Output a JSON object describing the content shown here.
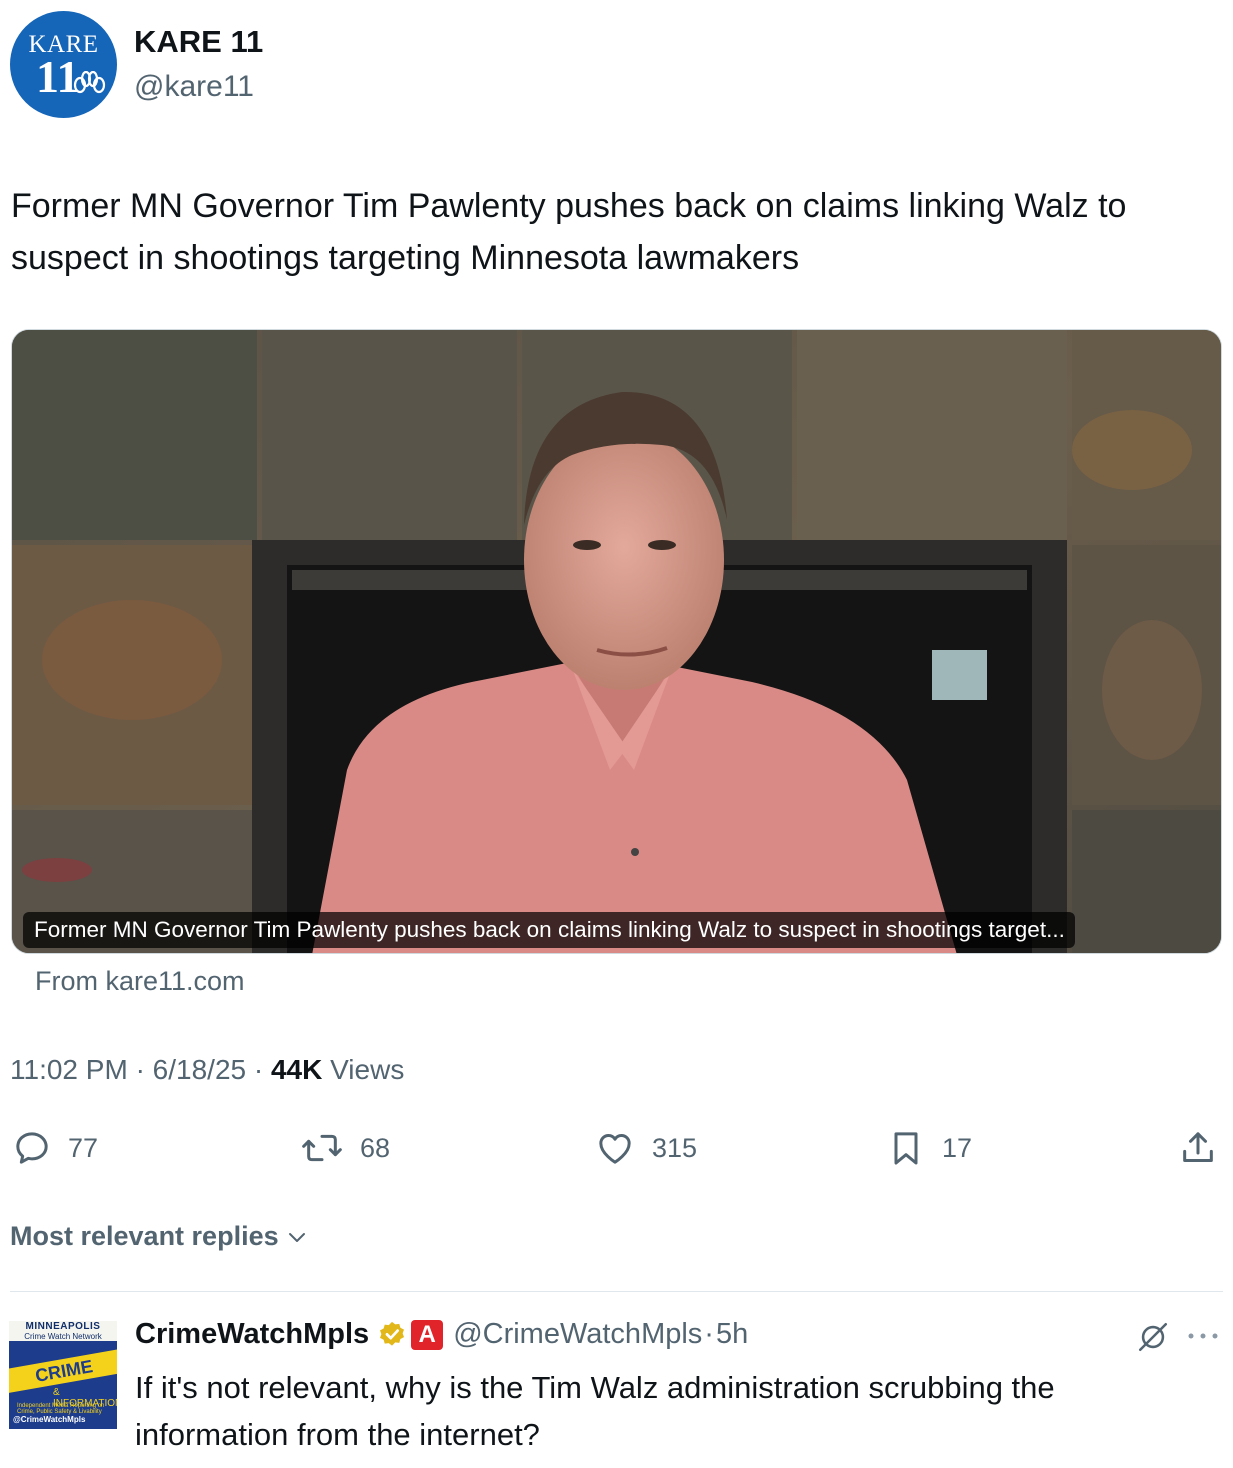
{
  "author": {
    "name": "KARE 11",
    "handle": "@kare11",
    "avatar_text_top": "KARE",
    "avatar_text_number": "11",
    "avatar_color": "#1565b8"
  },
  "tweet": {
    "text": "Former MN Governor Tim Pawlenty pushes back on claims linking Walz to suspect in shootings targeting Minnesota lawmakers",
    "media_caption": "Former MN Governor Tim Pawlenty pushes back on claims linking Walz to suspect in shootings target...",
    "source": "From kare11.com",
    "time": "11:02 PM",
    "date": "6/18/25",
    "views_count": "44K",
    "views_label": "Views"
  },
  "actions": {
    "replies": "77",
    "reposts": "68",
    "likes": "315",
    "bookmarks": "17"
  },
  "replies_section": {
    "sort_label": "Most relevant replies"
  },
  "reply": {
    "name": "CrimeWatchMpls",
    "handle": "@CrimeWatchMpls",
    "time": "5h",
    "text": "If it's not relevant, why is the Tim Walz administration scrubbing the information from the internet?",
    "avatar_lines": [
      "MINNEAPOLIS",
      "Crime Watch Network",
      "CRIME WATCH",
      "& INFORMATION",
      "Independent Media Reporting on Crime, Public Safety & Livability",
      "@CrimeWatchMpls"
    ],
    "badge_letter": "A"
  },
  "colors": {
    "text_primary": "#0f1419",
    "text_secondary": "#536471",
    "verified_gold": "#e2b719",
    "divider": "#e1e8ed"
  }
}
